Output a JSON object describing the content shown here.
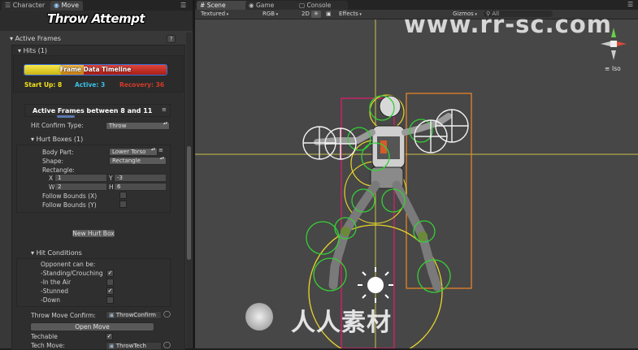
{
  "left_tabs": [
    "Character",
    "Move"
  ],
  "title": "Throw Attempt",
  "active_frames": {
    "label": "Active Frames"
  },
  "hits": {
    "label": "Hits (1)"
  },
  "timeline": {
    "label": "Frame Data Timeline",
    "startup": "Start Up: 8",
    "active": "Active: 3",
    "recovery": "Recovery: 36"
  },
  "active_between": {
    "label": "Active Frames between 8 and 11"
  },
  "hit_confirm": {
    "label": "Hit Confirm Type:",
    "value": "Throw"
  },
  "hurt_boxes": {
    "label": "Hurt Boxes (1)",
    "body_part_label": "Body Part:",
    "body_part_value": "Lower Torso",
    "shape_label": "Shape:",
    "shape_value": "Rectangle",
    "rectangle_label": "Rectangle:",
    "x_label": "X",
    "x_value": "1",
    "y_label": "Y",
    "y_value": "-3",
    "w_label": "W",
    "w_value": "2",
    "h_label": "H",
    "h_value": "6",
    "follow_x": "Follow Bounds (X)",
    "follow_y": "Follow Bounds (Y)",
    "new_button": "New Hurt Box"
  },
  "hit_conditions": {
    "label": "Hit Conditions",
    "opponent_label": "Opponent can be:",
    "items": [
      {
        "label": "-Standing/Crouching",
        "checked": true
      },
      {
        "label": "-In the Air",
        "checked": false
      },
      {
        "label": "-Stunned",
        "checked": true
      },
      {
        "label": "-Down",
        "checked": false
      }
    ]
  },
  "throw_confirm": {
    "label": "Throw Move Confirm:",
    "value": "ThrowConfirm"
  },
  "open_move": "Open Move",
  "techable": {
    "label": "Techable",
    "checked": true
  },
  "tech_move": {
    "label": "Tech Move:",
    "value": "ThrowTech"
  },
  "scene_tabs": [
    "Scene",
    "Game",
    "Console"
  ],
  "scene_toolbar": {
    "shading": "Textured",
    "mode": "RGB",
    "dim": "2D",
    "effects": "Effects",
    "gizmos": "Gizmos",
    "search": "All"
  },
  "view_label": "Iso",
  "watermark_top": "www.rr-sc.com",
  "watermark_bottom": "人人素材",
  "colors": {
    "startup": "#f2e21a",
    "active": "#39c0e6",
    "recovery": "#d23a2a",
    "timeline_border": "#3a6fd8"
  }
}
